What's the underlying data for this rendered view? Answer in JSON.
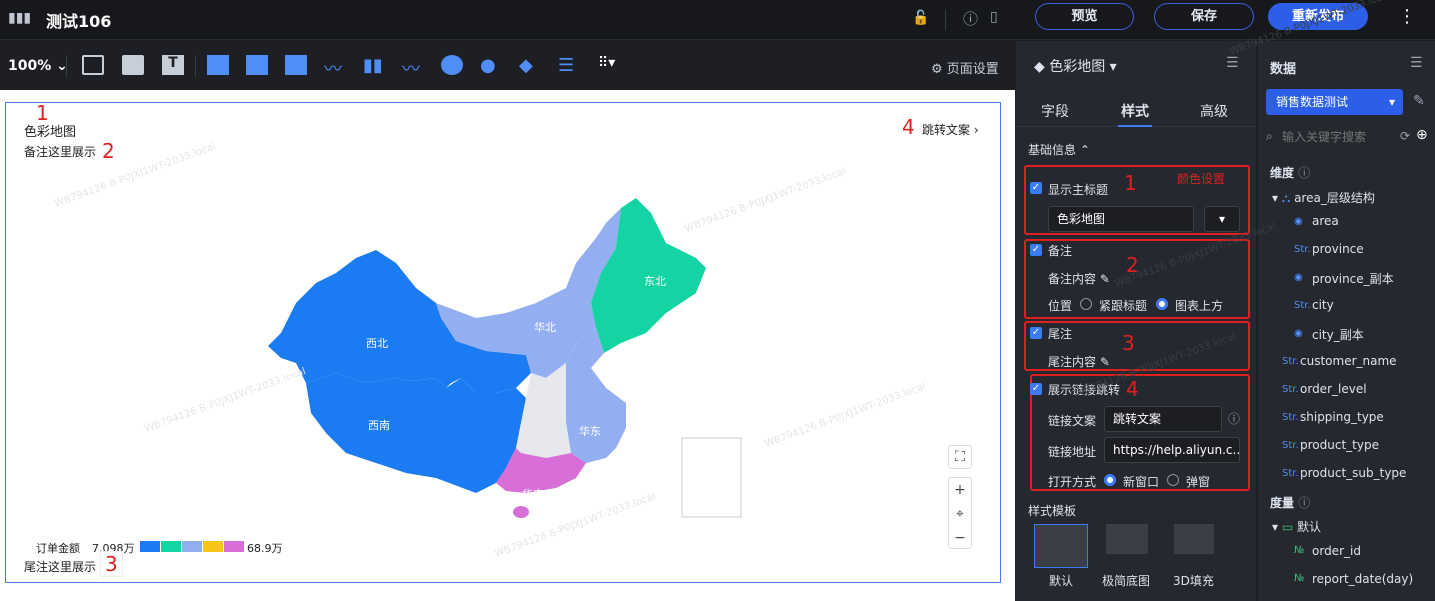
{
  "app": {
    "title": "测试106"
  },
  "top": {
    "preview": "预览",
    "save": "保存",
    "republish": "重新发布"
  },
  "toolbar": {
    "zoom": "100%",
    "page_settings": "页面设置"
  },
  "chart": {
    "title": "色彩地图",
    "note": "备注这里展示",
    "footnote": "尾注这里展示",
    "link_text": "跳转文案",
    "legend_label": "订单金额",
    "legend_min": "7.098万",
    "legend_max": "68.9万",
    "legend_colors": [
      "#1a7bf2",
      "#14d4a4",
      "#94aef2",
      "#f5c518",
      "#d86fd8"
    ],
    "regions": [
      {
        "name": "西北",
        "color": "#1a7bf2"
      },
      {
        "name": "西南",
        "color": "#1a7bf2"
      },
      {
        "name": "华北",
        "color": "#94aef2"
      },
      {
        "name": "东北",
        "color": "#14d4a4"
      },
      {
        "name": "华东",
        "color": "#94aef2"
      },
      {
        "name": "华南",
        "color": "#d86fd8"
      }
    ],
    "annotations": {
      "n1": "1",
      "n2": "2",
      "n3": "3",
      "n4": "4"
    }
  },
  "panel": {
    "chart_type": "色彩地图",
    "tabs": [
      "字段",
      "样式",
      "高级"
    ],
    "section": "基础信息",
    "show_title": "显示主标题",
    "title_value": "色彩地图",
    "color_setting": "颜色设置",
    "note": "备注",
    "note_content": "备注内容",
    "position": "位置",
    "pos_opt1": "紧跟标题",
    "pos_opt2": "图表上方",
    "footer": "尾注",
    "footer_content": "尾注内容",
    "show_link": "展示链接跳转",
    "link_text_label": "链接文案",
    "link_text_value": "跳转文案",
    "link_url_label": "链接地址",
    "link_url_value": "https://help.aliyun.c...",
    "open_mode": "打开方式",
    "open_opt1": "新窗口",
    "open_opt2": "弹窗",
    "template_section": "样式模板",
    "templates": [
      "默认",
      "极简底图",
      "3D填充"
    ],
    "box_nums": [
      "1",
      "2",
      "3",
      "4"
    ]
  },
  "data": {
    "title": "数据",
    "dataset": "销售数据测试",
    "search_placeholder": "输入关键字搜索",
    "dim_title": "维度",
    "hier": "area_层级结构",
    "dims": [
      "area",
      "province",
      "province_副本",
      "city",
      "city_副本",
      "customer_name",
      "order_level",
      "shipping_type",
      "product_type",
      "product_sub_type"
    ],
    "measure_title": "度量",
    "folder": "默认",
    "measures": [
      "order_id",
      "report_date(day)"
    ]
  },
  "watermark": "WB794126 B-P0JXJ1WT-2033.local"
}
